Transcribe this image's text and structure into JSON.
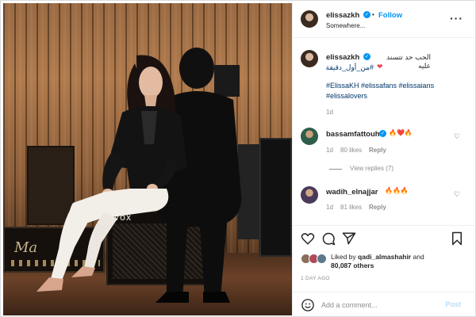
{
  "post": {
    "username": "elissazkh",
    "follow_label": "Follow",
    "separator": "•",
    "location": "Somewhere...",
    "caption": {
      "arabic": "الحب حد تتسند عليه",
      "heart": "❤",
      "arabic_tag": "#من_أول_دقيقة",
      "hashtags": "#ElissaKH #elissafans #elissaians #elissalovers",
      "age": "1d"
    },
    "photo": {
      "amp_left_brand": "Ma",
      "amp_vox_brand": "VOX"
    }
  },
  "comments": [
    {
      "username": "bassamfattouh",
      "text": "🔥❤️🔥",
      "age": "1d",
      "likes": "80 likes",
      "reply_label": "Reply",
      "view_replies": "View replies (7)"
    },
    {
      "username": "wadih_elnajjar",
      "text": "🔥🔥🔥",
      "age": "1d",
      "likes": "81 likes",
      "reply_label": "Reply"
    }
  ],
  "liked_by": {
    "prefix": "Liked by ",
    "user": "qadi_almashahir",
    "and": " and",
    "others": "80,087 others"
  },
  "time_ago": "1 DAY AGO",
  "add_comment": {
    "placeholder": "Add a comment...",
    "post_label": "Post"
  },
  "colors": {
    "link_blue": "#0095f6",
    "hashtag_blue": "#00376b",
    "heart_red": "#ed4956",
    "muted": "#8e8e8e"
  },
  "icons": [
    "heart-icon",
    "comment-icon",
    "share-icon",
    "bookmark-icon",
    "emoji-icon",
    "more-icon",
    "verified-icon"
  ]
}
